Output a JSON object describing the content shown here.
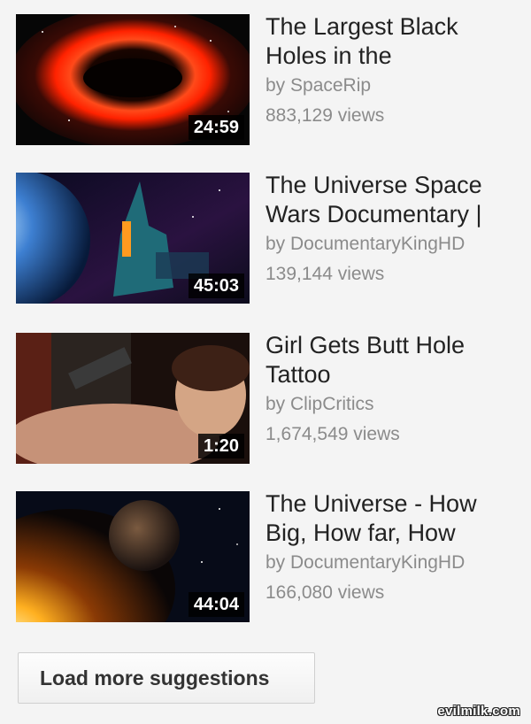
{
  "suggestions": [
    {
      "title_line1": "The Largest Black",
      "title_line2": "Holes in the",
      "channel": "by SpaceRip",
      "views": "883,129 views",
      "duration": "24:59"
    },
    {
      "title_line1": "The Universe Space",
      "title_line2": "Wars Documentary |",
      "channel": "by DocumentaryKingHD",
      "views": "139,144 views",
      "duration": "45:03"
    },
    {
      "title_line1": "Girl Gets Butt Hole",
      "title_line2": "Tattoo",
      "channel": "by ClipCritics",
      "views": "1,674,549 views",
      "duration": "1:20"
    },
    {
      "title_line1": "The Universe - How",
      "title_line2": "Big, How far, How",
      "channel": "by DocumentaryKingHD",
      "views": "166,080 views",
      "duration": "44:04"
    }
  ],
  "load_more_label": "Load more suggestions",
  "watermark": "evilmilk.com"
}
